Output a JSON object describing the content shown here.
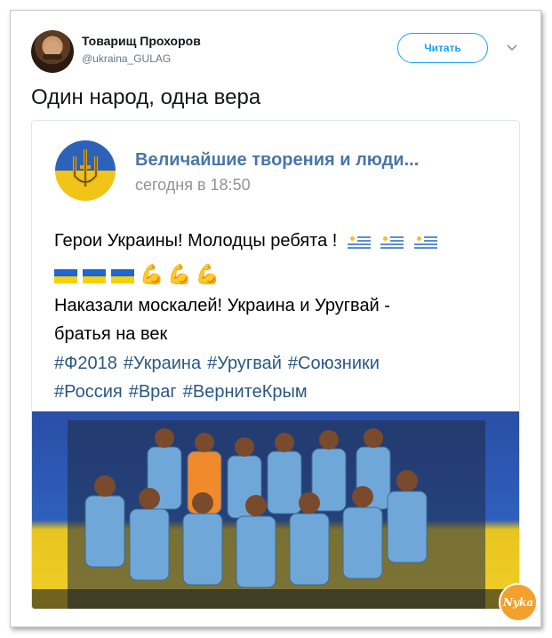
{
  "author": {
    "name": "Товарищ Прохоров",
    "handle": "@ukraina_GULAG"
  },
  "follow_label": "Читать",
  "tweet_text": "Один народ, одна вера",
  "card": {
    "group_name": "Величайшие творения и люди...",
    "post_time": "сегодня в 18:50",
    "line1": "Герои Украины! Молодцы ребята !",
    "line2": "Наказали москалей! Украина и Уругвай -",
    "line3": "братья на век",
    "hashtags_row1": [
      "#Ф2018",
      "#Украина",
      "#Уругвай",
      "#Союзники"
    ],
    "hashtags_row2": [
      "#Россия",
      "#Враг",
      "#ВернитеКрым"
    ]
  },
  "watermark": "Nyka",
  "colors": {
    "link": "#2a5885",
    "group_name": "#4a76a8",
    "twitter_blue": "#1da1f2",
    "ua_blue": "#1f66d1",
    "ua_yellow": "#f5d10b",
    "uy_blue": "#5a8fd6"
  }
}
